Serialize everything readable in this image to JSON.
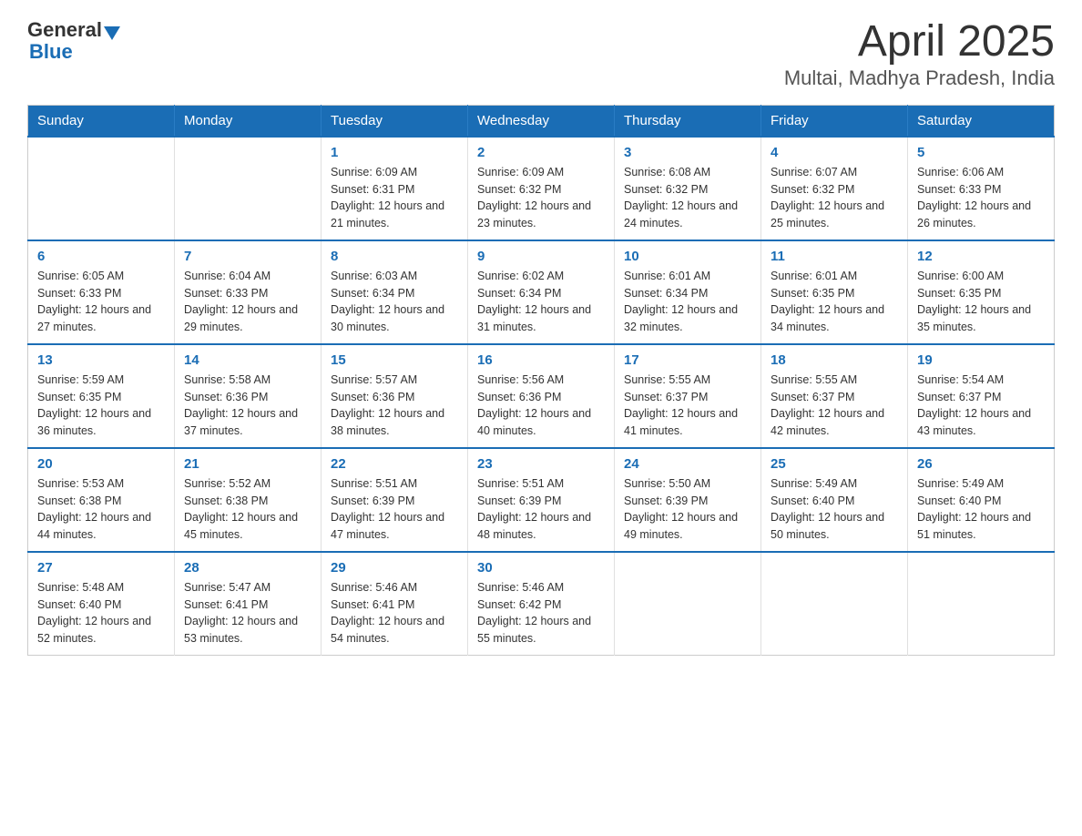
{
  "logo": {
    "text_general": "General",
    "text_blue": "Blue"
  },
  "header": {
    "title": "April 2025",
    "subtitle": "Multai, Madhya Pradesh, India"
  },
  "weekdays": [
    "Sunday",
    "Monday",
    "Tuesday",
    "Wednesday",
    "Thursday",
    "Friday",
    "Saturday"
  ],
  "weeks": [
    [
      {
        "day": "",
        "sunrise": "",
        "sunset": "",
        "daylight": ""
      },
      {
        "day": "",
        "sunrise": "",
        "sunset": "",
        "daylight": ""
      },
      {
        "day": "1",
        "sunrise": "Sunrise: 6:09 AM",
        "sunset": "Sunset: 6:31 PM",
        "daylight": "Daylight: 12 hours and 21 minutes."
      },
      {
        "day": "2",
        "sunrise": "Sunrise: 6:09 AM",
        "sunset": "Sunset: 6:32 PM",
        "daylight": "Daylight: 12 hours and 23 minutes."
      },
      {
        "day": "3",
        "sunrise": "Sunrise: 6:08 AM",
        "sunset": "Sunset: 6:32 PM",
        "daylight": "Daylight: 12 hours and 24 minutes."
      },
      {
        "day": "4",
        "sunrise": "Sunrise: 6:07 AM",
        "sunset": "Sunset: 6:32 PM",
        "daylight": "Daylight: 12 hours and 25 minutes."
      },
      {
        "day": "5",
        "sunrise": "Sunrise: 6:06 AM",
        "sunset": "Sunset: 6:33 PM",
        "daylight": "Daylight: 12 hours and 26 minutes."
      }
    ],
    [
      {
        "day": "6",
        "sunrise": "Sunrise: 6:05 AM",
        "sunset": "Sunset: 6:33 PM",
        "daylight": "Daylight: 12 hours and 27 minutes."
      },
      {
        "day": "7",
        "sunrise": "Sunrise: 6:04 AM",
        "sunset": "Sunset: 6:33 PM",
        "daylight": "Daylight: 12 hours and 29 minutes."
      },
      {
        "day": "8",
        "sunrise": "Sunrise: 6:03 AM",
        "sunset": "Sunset: 6:34 PM",
        "daylight": "Daylight: 12 hours and 30 minutes."
      },
      {
        "day": "9",
        "sunrise": "Sunrise: 6:02 AM",
        "sunset": "Sunset: 6:34 PM",
        "daylight": "Daylight: 12 hours and 31 minutes."
      },
      {
        "day": "10",
        "sunrise": "Sunrise: 6:01 AM",
        "sunset": "Sunset: 6:34 PM",
        "daylight": "Daylight: 12 hours and 32 minutes."
      },
      {
        "day": "11",
        "sunrise": "Sunrise: 6:01 AM",
        "sunset": "Sunset: 6:35 PM",
        "daylight": "Daylight: 12 hours and 34 minutes."
      },
      {
        "day": "12",
        "sunrise": "Sunrise: 6:00 AM",
        "sunset": "Sunset: 6:35 PM",
        "daylight": "Daylight: 12 hours and 35 minutes."
      }
    ],
    [
      {
        "day": "13",
        "sunrise": "Sunrise: 5:59 AM",
        "sunset": "Sunset: 6:35 PM",
        "daylight": "Daylight: 12 hours and 36 minutes."
      },
      {
        "day": "14",
        "sunrise": "Sunrise: 5:58 AM",
        "sunset": "Sunset: 6:36 PM",
        "daylight": "Daylight: 12 hours and 37 minutes."
      },
      {
        "day": "15",
        "sunrise": "Sunrise: 5:57 AM",
        "sunset": "Sunset: 6:36 PM",
        "daylight": "Daylight: 12 hours and 38 minutes."
      },
      {
        "day": "16",
        "sunrise": "Sunrise: 5:56 AM",
        "sunset": "Sunset: 6:36 PM",
        "daylight": "Daylight: 12 hours and 40 minutes."
      },
      {
        "day": "17",
        "sunrise": "Sunrise: 5:55 AM",
        "sunset": "Sunset: 6:37 PM",
        "daylight": "Daylight: 12 hours and 41 minutes."
      },
      {
        "day": "18",
        "sunrise": "Sunrise: 5:55 AM",
        "sunset": "Sunset: 6:37 PM",
        "daylight": "Daylight: 12 hours and 42 minutes."
      },
      {
        "day": "19",
        "sunrise": "Sunrise: 5:54 AM",
        "sunset": "Sunset: 6:37 PM",
        "daylight": "Daylight: 12 hours and 43 minutes."
      }
    ],
    [
      {
        "day": "20",
        "sunrise": "Sunrise: 5:53 AM",
        "sunset": "Sunset: 6:38 PM",
        "daylight": "Daylight: 12 hours and 44 minutes."
      },
      {
        "day": "21",
        "sunrise": "Sunrise: 5:52 AM",
        "sunset": "Sunset: 6:38 PM",
        "daylight": "Daylight: 12 hours and 45 minutes."
      },
      {
        "day": "22",
        "sunrise": "Sunrise: 5:51 AM",
        "sunset": "Sunset: 6:39 PM",
        "daylight": "Daylight: 12 hours and 47 minutes."
      },
      {
        "day": "23",
        "sunrise": "Sunrise: 5:51 AM",
        "sunset": "Sunset: 6:39 PM",
        "daylight": "Daylight: 12 hours and 48 minutes."
      },
      {
        "day": "24",
        "sunrise": "Sunrise: 5:50 AM",
        "sunset": "Sunset: 6:39 PM",
        "daylight": "Daylight: 12 hours and 49 minutes."
      },
      {
        "day": "25",
        "sunrise": "Sunrise: 5:49 AM",
        "sunset": "Sunset: 6:40 PM",
        "daylight": "Daylight: 12 hours and 50 minutes."
      },
      {
        "day": "26",
        "sunrise": "Sunrise: 5:49 AM",
        "sunset": "Sunset: 6:40 PM",
        "daylight": "Daylight: 12 hours and 51 minutes."
      }
    ],
    [
      {
        "day": "27",
        "sunrise": "Sunrise: 5:48 AM",
        "sunset": "Sunset: 6:40 PM",
        "daylight": "Daylight: 12 hours and 52 minutes."
      },
      {
        "day": "28",
        "sunrise": "Sunrise: 5:47 AM",
        "sunset": "Sunset: 6:41 PM",
        "daylight": "Daylight: 12 hours and 53 minutes."
      },
      {
        "day": "29",
        "sunrise": "Sunrise: 5:46 AM",
        "sunset": "Sunset: 6:41 PM",
        "daylight": "Daylight: 12 hours and 54 minutes."
      },
      {
        "day": "30",
        "sunrise": "Sunrise: 5:46 AM",
        "sunset": "Sunset: 6:42 PM",
        "daylight": "Daylight: 12 hours and 55 minutes."
      },
      {
        "day": "",
        "sunrise": "",
        "sunset": "",
        "daylight": ""
      },
      {
        "day": "",
        "sunrise": "",
        "sunset": "",
        "daylight": ""
      },
      {
        "day": "",
        "sunrise": "",
        "sunset": "",
        "daylight": ""
      }
    ]
  ]
}
